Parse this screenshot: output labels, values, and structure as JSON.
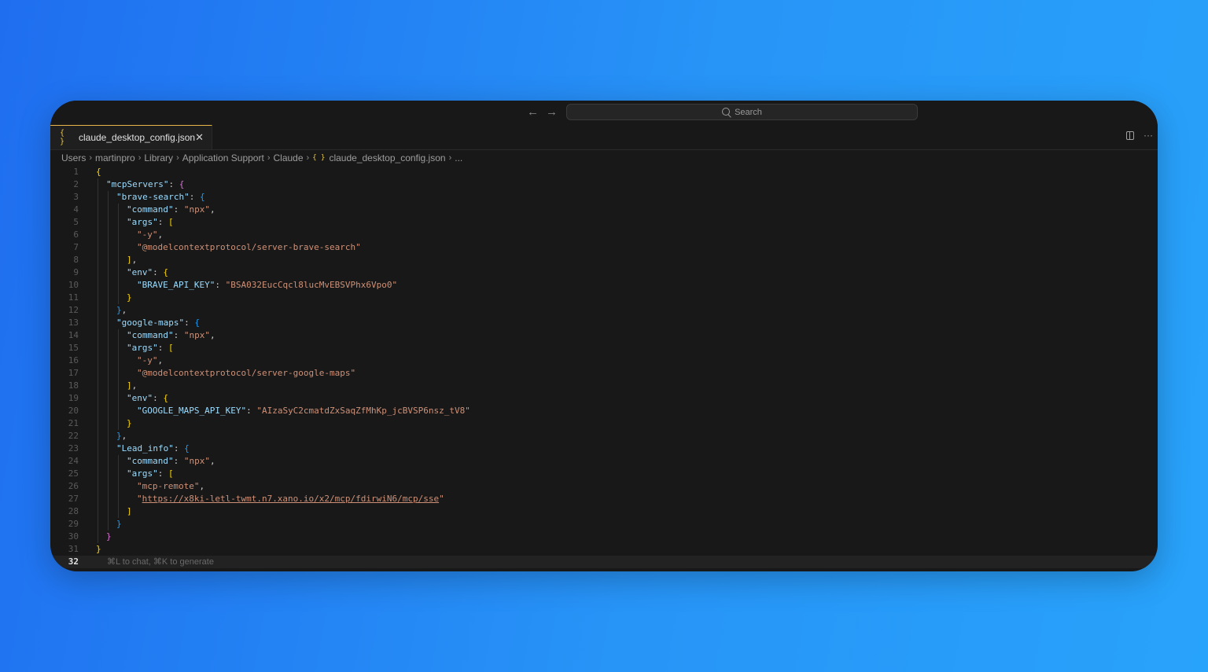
{
  "titlebar": {
    "back_icon": "arrow-left-icon",
    "forward_icon": "arrow-right-icon",
    "search_placeholder": "Search"
  },
  "tab": {
    "icon": "{ }",
    "label": "claude_desktop_config.json",
    "close": "✕"
  },
  "tab_actions": {
    "more": "···"
  },
  "breadcrumb": {
    "items": [
      "Users",
      "martinpro",
      "Library",
      "Application Support",
      "Claude"
    ],
    "file_icon": "{ }",
    "file": "claude_desktop_config.json",
    "trailing": "..."
  },
  "editor": {
    "line_numbers": [
      "1",
      "2",
      "3",
      "4",
      "5",
      "6",
      "7",
      "8",
      "9",
      "10",
      "11",
      "12",
      "13",
      "14",
      "15",
      "16",
      "17",
      "18",
      "19",
      "20",
      "21",
      "22",
      "23",
      "24",
      "25",
      "26",
      "27",
      "28",
      "29",
      "30",
      "31",
      "32"
    ],
    "active_line": "32",
    "hint": "⌘L to chat, ⌘K to generate",
    "keys": {
      "mcpServers": "\"mcpServers\"",
      "brave": "\"brave-search\"",
      "command": "\"command\"",
      "args": "\"args\"",
      "env": "\"env\"",
      "brave_key": "\"BRAVE_API_KEY\"",
      "gmaps": "\"google-maps\"",
      "gmaps_key": "\"GOOGLE_MAPS_API_KEY\"",
      "lead": "\"Lead_info\""
    },
    "values": {
      "npx": "\"npx\"",
      "y": "\"-y\"",
      "brave_pkg": "\"@modelcontextprotocol/server-brave-search\"",
      "brave_val": "\"BSA032EucCqcl8lucMvEBSVPhx6Vpo0\"",
      "gmaps_pkg": "\"@modelcontextprotocol/server-google-maps\"",
      "gmaps_val": "\"AIzaSyC2cmatdZxSaqZfMhKp_jcBVSP6nsz_tV8\"",
      "mcp_remote": "\"mcp-remote\"",
      "url": "https://x8ki-letl-twmt.n7.xano.io/x2/mcp/fdirwiN6/mcp/sse"
    }
  }
}
